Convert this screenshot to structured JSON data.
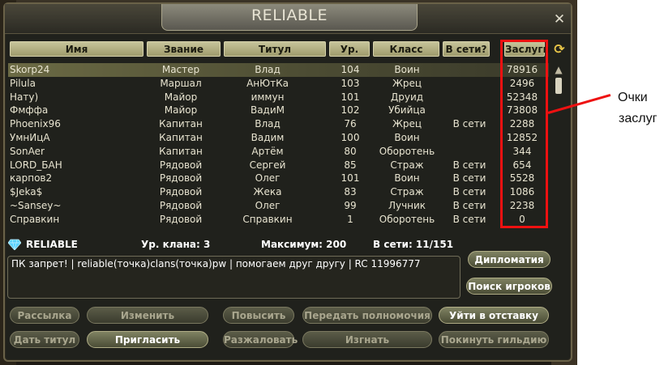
{
  "window": {
    "title": "RELIABLE",
    "close_glyph": "✕"
  },
  "table": {
    "headers": {
      "name": "Имя",
      "rank": "Звание",
      "title": "Титул",
      "level": "Ур.",
      "class": "Класс",
      "online": "В сети?",
      "merit": "Заслуги"
    },
    "rows": [
      {
        "name": "Skorp24",
        "rank": "Мастер",
        "title": "Влад",
        "level": "104",
        "class": "Воин",
        "online": "",
        "merit": "78916",
        "selected": true
      },
      {
        "name": "Pilula",
        "rank": "Маршал",
        "title": "АнЮтКа",
        "level": "103",
        "class": "Жрец",
        "online": "",
        "merit": "2496"
      },
      {
        "name": "Нату)",
        "rank": "Майор",
        "title": "иммун",
        "level": "101",
        "class": "Друид",
        "online": "",
        "merit": "52348"
      },
      {
        "name": "Фмффа",
        "rank": "Майор",
        "title": "ВадиМ",
        "level": "102",
        "class": "Убийца",
        "online": "",
        "merit": "73808"
      },
      {
        "name": "Phoenix96",
        "rank": "Капитан",
        "title": "Влад",
        "level": "76",
        "class": "Жрец",
        "online": "В сети",
        "merit": "2288"
      },
      {
        "name": "УмнИцА",
        "rank": "Капитан",
        "title": "Вадим",
        "level": "100",
        "class": "Воин",
        "online": "",
        "merit": "12852"
      },
      {
        "name": "SonAer",
        "rank": "Капитан",
        "title": "Артём",
        "level": "80",
        "class": "Оборотень",
        "online": "",
        "merit": "344"
      },
      {
        "name": "LORD_БАН",
        "rank": "Рядовой",
        "title": "Сергей",
        "level": "85",
        "class": "Страж",
        "online": "В сети",
        "merit": "654"
      },
      {
        "name": "карпов2",
        "rank": "Рядовой",
        "title": "Олег",
        "level": "101",
        "class": "Воин",
        "online": "В сети",
        "merit": "5528"
      },
      {
        "name": "$Jeka$",
        "rank": "Рядовой",
        "title": "Жека",
        "level": "83",
        "class": "Страж",
        "online": "В сети",
        "merit": "1086"
      },
      {
        "name": "~Sansey~",
        "rank": "Рядовой",
        "title": "Олег",
        "level": "99",
        "class": "Лучник",
        "online": "В сети",
        "merit": "2238"
      },
      {
        "name": "Справкин",
        "rank": "Рядовой",
        "title": "Справкин",
        "level": "1",
        "class": "Оборотень",
        "online": "В сети",
        "merit": "0"
      }
    ]
  },
  "clan_info": {
    "name": "RELIABLE",
    "level_label": "Ур. клана: 3",
    "max_label": "Максимум: 200",
    "online_label": "В сети: 11/151"
  },
  "notice": "ПК запрет! | reliable(точка)clans(точка)pw | помогаем друг другу | RC 11996777",
  "buttons": {
    "diplomacy": "Дипломатия",
    "search_players": "Поиск игроков",
    "mailing": "Рассылка",
    "change": "Изменить",
    "promote": "Повысить",
    "transfer": "Передать полномочия",
    "resign": "Уйти в отставку",
    "give_title": "Дать титул",
    "invite": "Пригласить",
    "demote": "Разжаловать",
    "kick": "Изгнать",
    "leave_guild": "Покинуть гильдию"
  },
  "annotation": {
    "line1": "Очки",
    "line2": "заслуг"
  },
  "icons": {
    "refresh": "refresh-icon",
    "close": "close-icon",
    "gem": "gem-icon",
    "scroll_up": "scroll-up-icon"
  },
  "colors": {
    "highlight": "#ee1111",
    "panel": "#20211c",
    "header_bg": "#b8b58a",
    "gem": "#5ad2ff"
  }
}
